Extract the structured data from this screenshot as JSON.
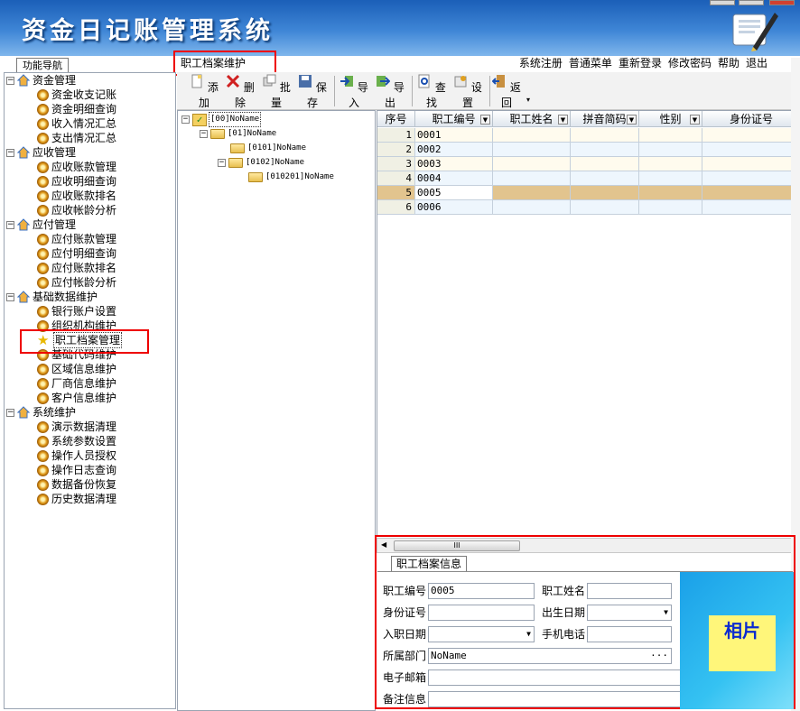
{
  "app": {
    "title": "资金日记账管理系统"
  },
  "top_menu": [
    "系统注册",
    "普通菜单",
    "重新登录",
    "修改密码",
    "帮助",
    "退出"
  ],
  "nav_tab": "功能导航",
  "module_title": "职工档案维护",
  "nav_tree": [
    {
      "label": "资金管理",
      "children": [
        "资金收支记账",
        "资金明细查询",
        "收入情况汇总",
        "支出情况汇总"
      ]
    },
    {
      "label": "应收管理",
      "children": [
        "应收账款管理",
        "应收明细查询",
        "应收账款排名",
        "应收帐龄分析"
      ]
    },
    {
      "label": "应付管理",
      "children": [
        "应付账款管理",
        "应付明细查询",
        "应付账款排名",
        "应付帐龄分析"
      ]
    },
    {
      "label": "基础数据维护",
      "children": [
        "银行账户设置",
        "组织机构维护",
        "职工档案管理",
        "基础代码维护",
        "区域信息维护",
        "厂商信息维护",
        "客户信息维护"
      ]
    },
    {
      "label": "系统维护",
      "children": [
        "演示数据清理",
        "系统参数设置",
        "操作人员授权",
        "操作日志查询",
        "数据备份恢复",
        "历史数据清理"
      ]
    }
  ],
  "toolbar": {
    "add": "添加",
    "delete": "删除",
    "batch": "批量",
    "save": "保存",
    "import": "导入",
    "export": "导出",
    "find": "查找",
    "settings": "设置",
    "back": "返回"
  },
  "org_tree": [
    "[00]NoName",
    "[01]NoName",
    "[0101]NoName",
    "[0102]NoName",
    "[010201]NoName"
  ],
  "grid": {
    "columns": [
      "序号",
      "职工编号",
      "职工姓名",
      "拼音简码",
      "性别",
      "身份证号"
    ],
    "rows": [
      [
        "1",
        "0001"
      ],
      [
        "2",
        "0002"
      ],
      [
        "3",
        "0003"
      ],
      [
        "4",
        "0004"
      ],
      [
        "5",
        "0005"
      ],
      [
        "6",
        "0006"
      ]
    ],
    "selected_index": 4
  },
  "detail": {
    "tab": "职工档案信息",
    "emp_no_label": "职工编号",
    "emp_no_value": "0005",
    "emp_name_label": "职工姓名",
    "emp_name_value": "",
    "id_label": "身份证号",
    "id_value": "",
    "birth_label": "出生日期",
    "birth_value": "",
    "hire_label": "入职日期",
    "hire_value": "",
    "phone_label": "手机电话",
    "phone_value": "",
    "dept_label": "所属部门",
    "dept_value": "NoName",
    "email_label": "电子邮箱",
    "email_value": "",
    "note_label": "备注信息",
    "note_value": "",
    "photo_label": "相片"
  }
}
